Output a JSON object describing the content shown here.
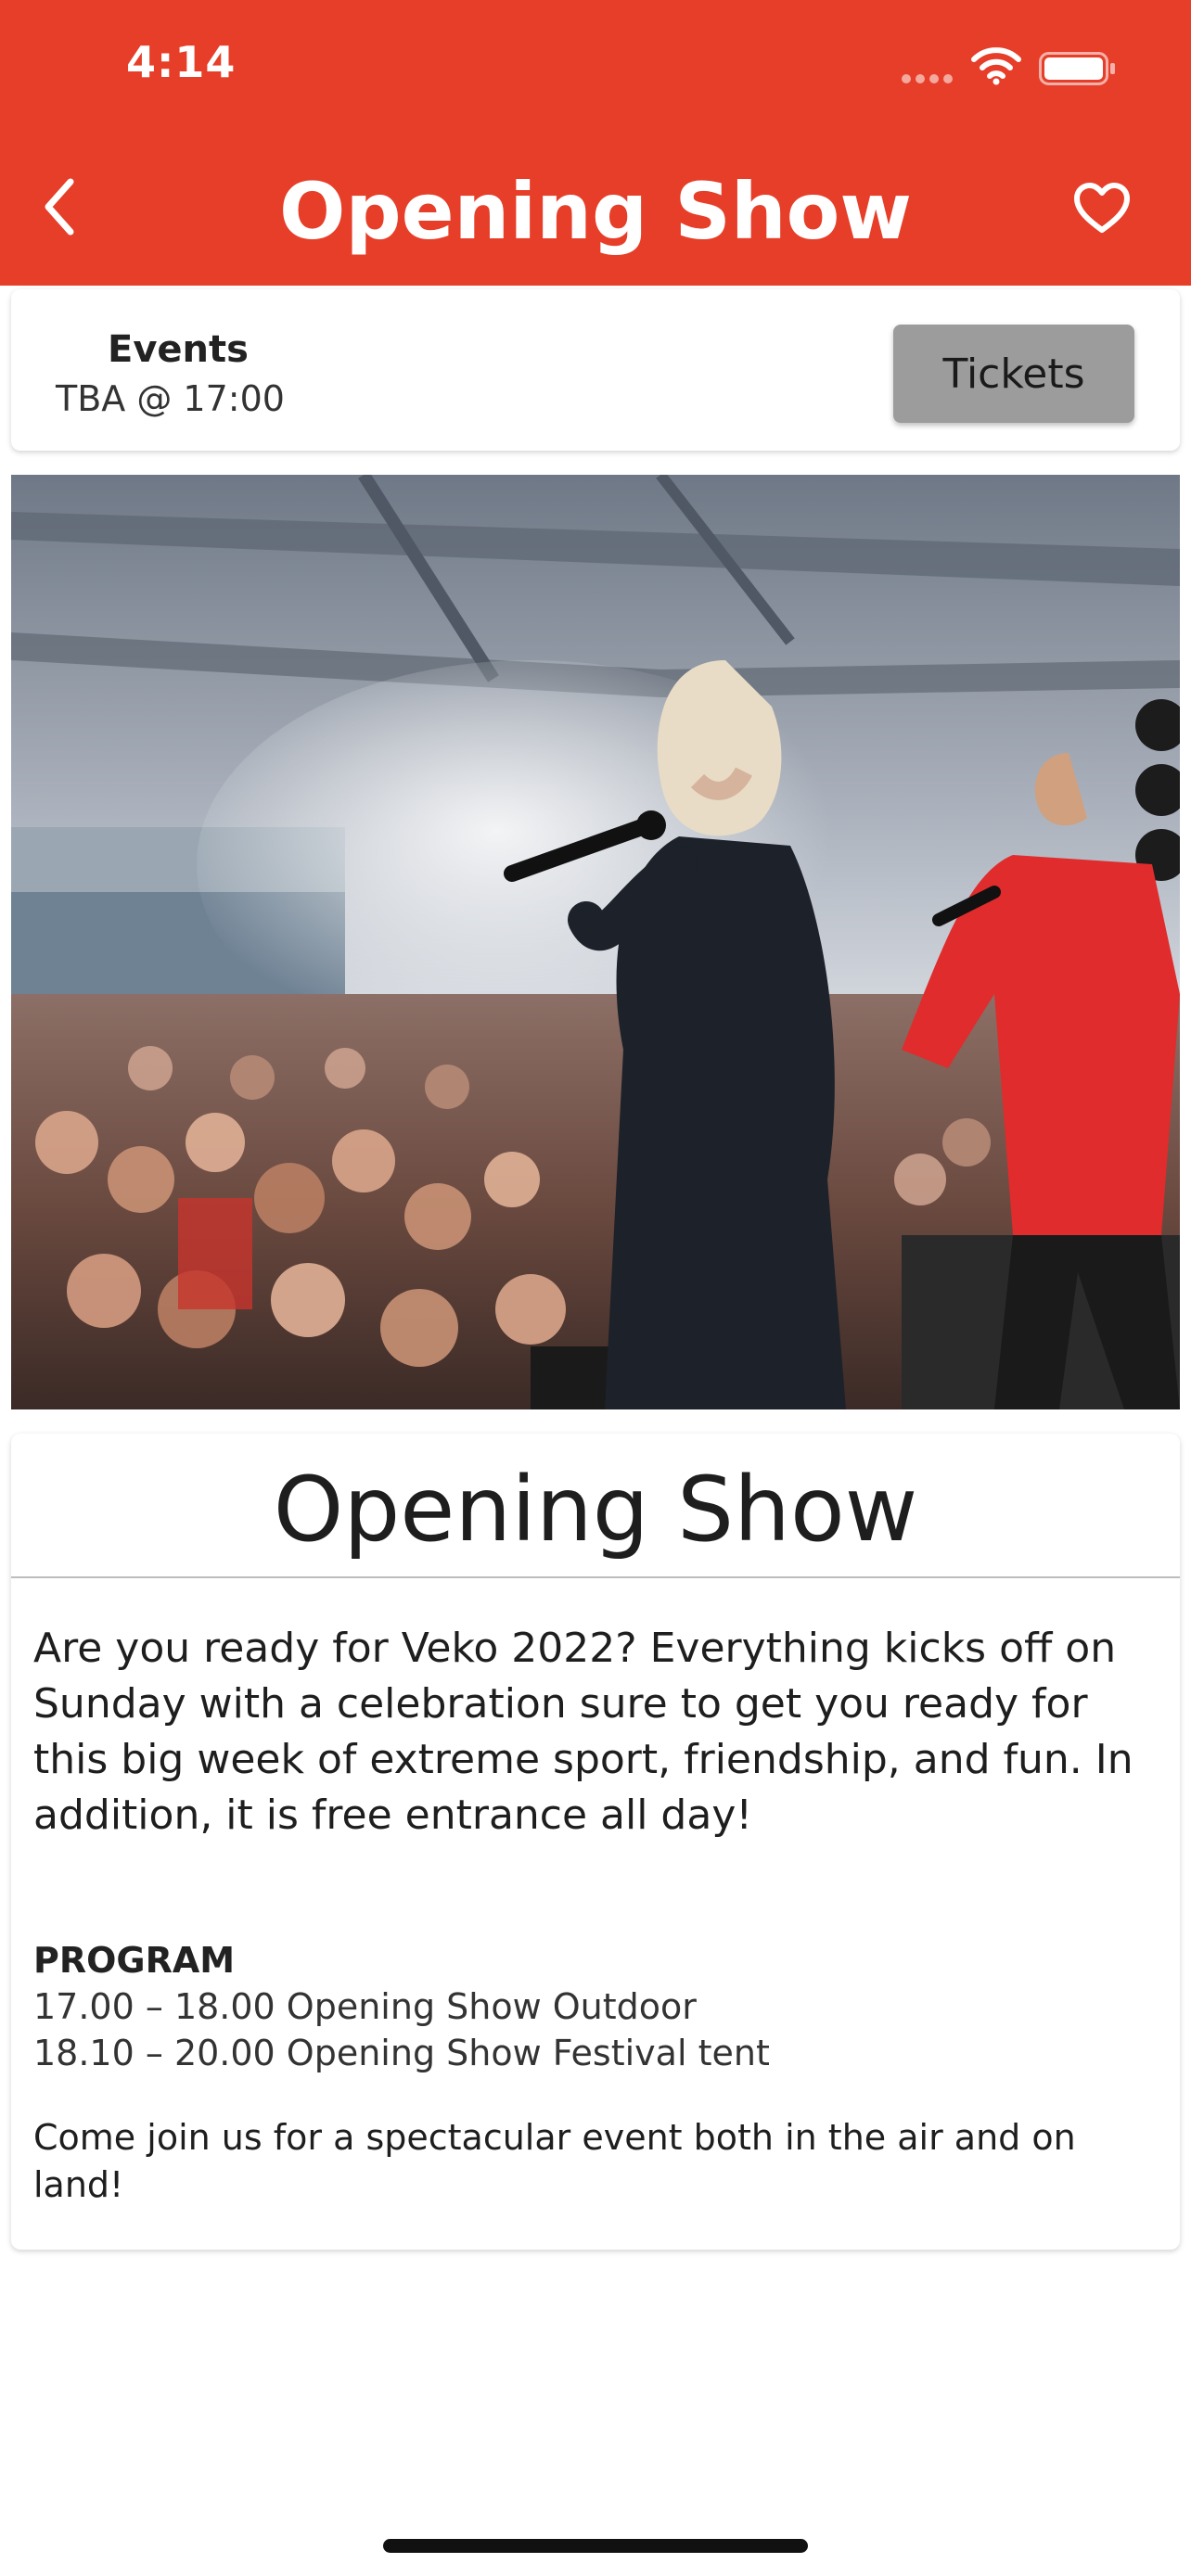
{
  "status_bar": {
    "time": "4:14"
  },
  "nav": {
    "title": "Opening Show",
    "back_icon": "chevron-left-icon",
    "favorite_icon": "heart-outline-icon"
  },
  "event": {
    "category": "Events",
    "time": "TBA @ 17:00",
    "tickets_label": "Tickets"
  },
  "content": {
    "title": "Opening Show",
    "intro": "Are you ready for Veko 2022? Everything kicks off on Sunday with a celebration sure to get you ready for this big week of extreme sport, friendship, and fun. In addition, it is free entrance all day!",
    "program_heading": "PROGRAM",
    "program": [
      "17.00 – 18.00 Opening Show Outdoor",
      "18.10 – 20.00 Opening Show Festival tent"
    ],
    "closing": "Come join us for a spectacular event both in the air and on land!"
  },
  "colors": {
    "brand": "#e63e28",
    "tickets_button": "#9c9c9c"
  }
}
